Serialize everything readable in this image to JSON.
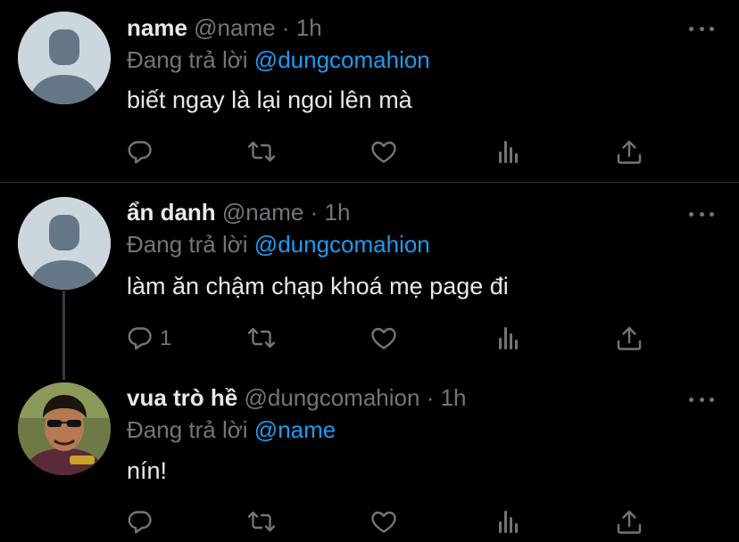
{
  "colors": {
    "background": "#000000",
    "text": "#e7e9ea",
    "muted": "#71767b",
    "link": "#1d9bf0",
    "divider": "#2f3336"
  },
  "tweets": [
    {
      "display_name": "name",
      "handle": "@name",
      "dot": "·",
      "time": "1h",
      "reply_prefix": "Đang trả lời",
      "reply_mention": "@dungcomahion",
      "text": "biết ngay là lại ngoi lên mà",
      "reply_count": ""
    },
    {
      "display_name": "ẩn danh",
      "handle": "@name",
      "dot": "·",
      "time": "1h",
      "reply_prefix": "Đang trả lời",
      "reply_mention": "@dungcomahion",
      "text": "làm ăn chậm chạp khoá mẹ page đi",
      "reply_count": "1"
    },
    {
      "display_name": "vua trò hề",
      "handle": "@dungcomahion",
      "dot": "·",
      "time": "1h",
      "reply_prefix": "Đang trả lời",
      "reply_mention": "@name",
      "text": "nín!",
      "reply_count": ""
    }
  ],
  "icons": {
    "reply": "reply-icon",
    "retweet": "retweet-icon",
    "like": "heart-icon",
    "stats": "analytics-icon",
    "share": "share-icon",
    "more": "more-icon",
    "avatar_default": "default-avatar-icon"
  }
}
